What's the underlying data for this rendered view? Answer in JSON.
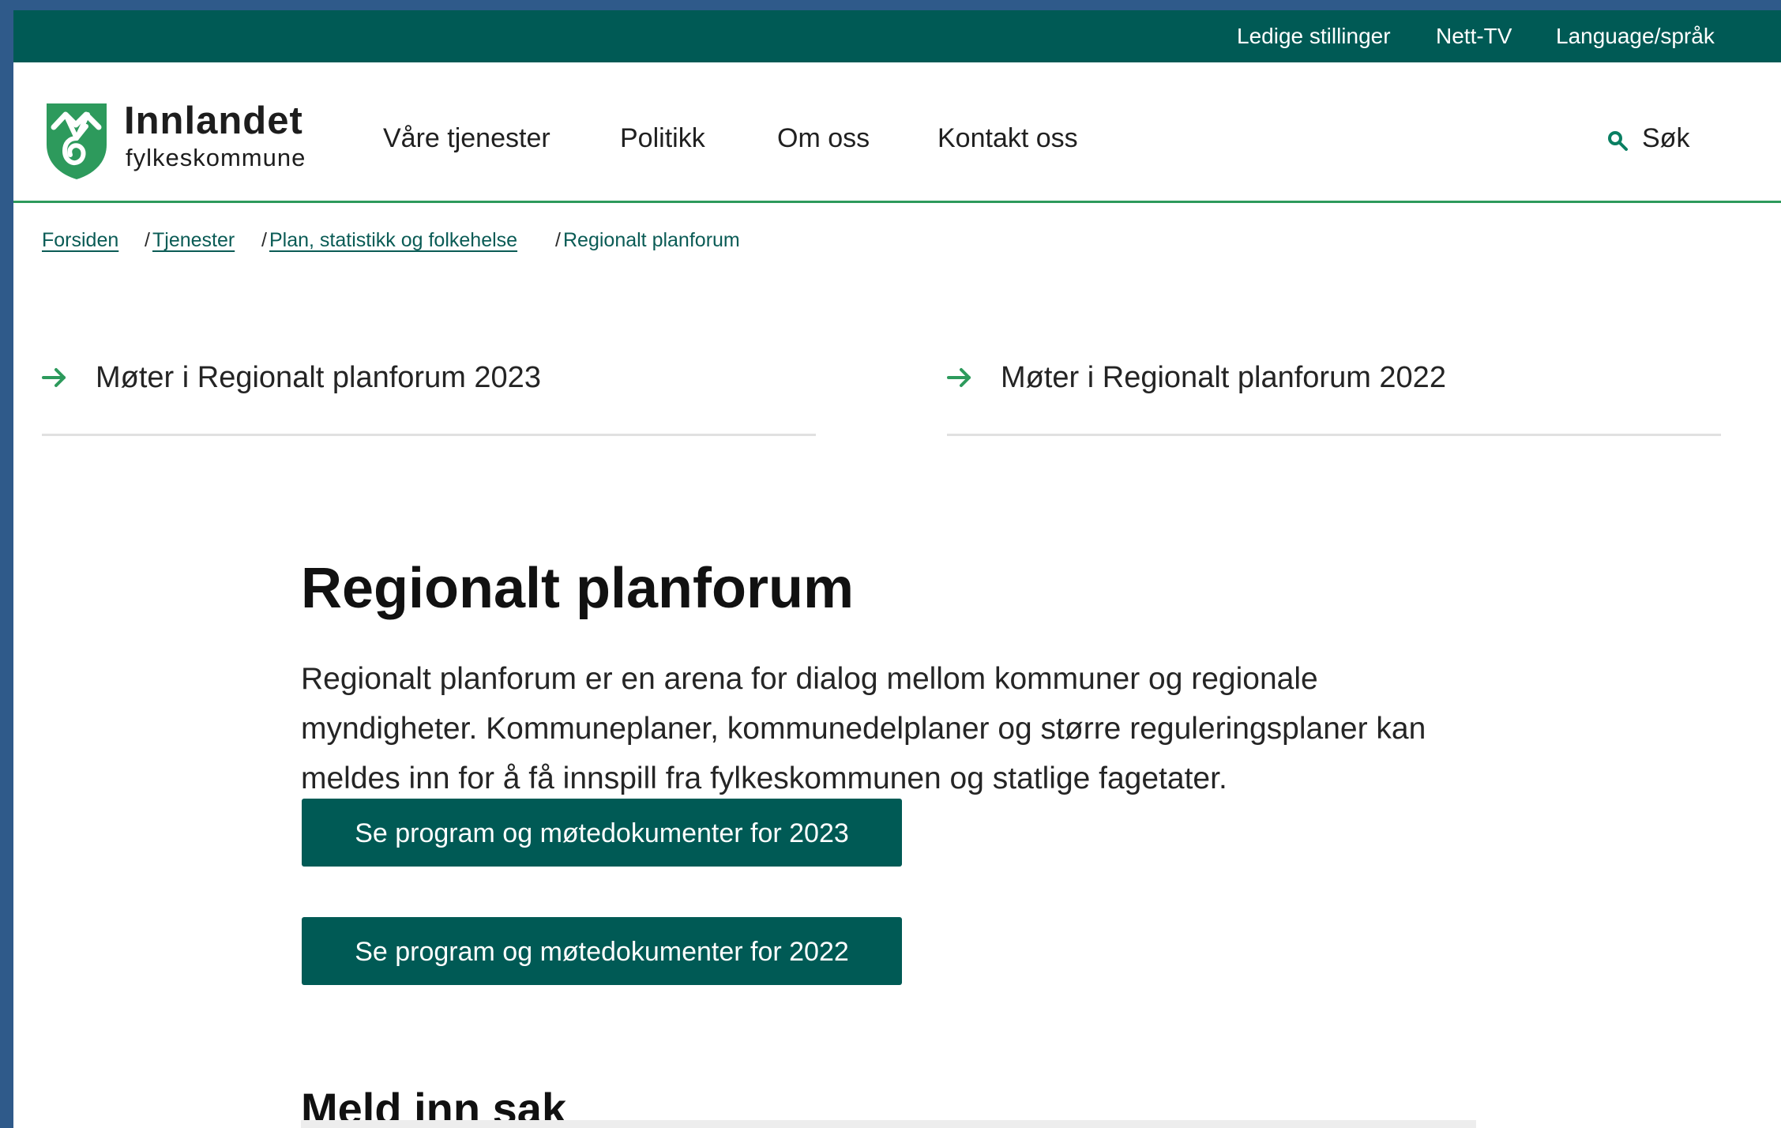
{
  "top_links": [
    "Ledige stillinger",
    "Nett-TV",
    "Language/språk"
  ],
  "logo": {
    "title": "Innlandet",
    "subtitle": "fylkeskommune",
    "icon": "shield-icon"
  },
  "nav": {
    "items": [
      "Våre tjenester",
      "Politikk",
      "Om oss",
      "Kontakt oss"
    ],
    "search_label": "Søk",
    "search_icon": "search-icon"
  },
  "breadcrumb": {
    "items": [
      "Forsiden",
      "Tjenester",
      "Plan, statistikk og folkehelse"
    ],
    "separator": "/",
    "current": "Regionalt planforum"
  },
  "related_links": [
    {
      "label": "Møter i Regionalt planforum 2023",
      "icon": "arrow-right-icon"
    },
    {
      "label": "Møter i Regionalt planforum 2022",
      "icon": "arrow-right-icon"
    }
  ],
  "main": {
    "title": "Regionalt planforum",
    "intro": "Regionalt planforum er en arena for dialog mellom kommuner og regionale myndigheter. Kommuneplaner, kommunedelplaner og større reguleringsplaner kan meldes inn for å få innspill fra fylkeskommunen og statlige fagetater.",
    "buttons": [
      "Se program og møtedokumenter for 2023",
      "Se program og møtedokumenter for 2022"
    ],
    "section_title": "Meld inn sak"
  },
  "colors": {
    "outer_background": "#2f5a8a",
    "brand_dark_green": "#005a55",
    "accent_green": "#2d9a5c",
    "text_dark": "#111111",
    "divider": "#e1e1e1"
  }
}
